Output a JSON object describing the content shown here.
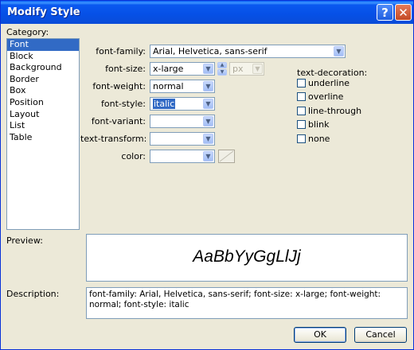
{
  "window": {
    "title": "Modify Style",
    "help_glyph": "?",
    "close_glyph": "✕"
  },
  "category": {
    "label": "Category:",
    "items": [
      "Font",
      "Block",
      "Background",
      "Border",
      "Box",
      "Position",
      "Layout",
      "List",
      "Table"
    ],
    "selected": "Font"
  },
  "font": {
    "family_label": "font-family:",
    "family_value": "Arial, Helvetica, sans-serif",
    "size_label": "font-size:",
    "size_value": "x-large",
    "size_unit": "px",
    "weight_label": "font-weight:",
    "weight_value": "normal",
    "style_label": "font-style:",
    "style_value": "italic",
    "variant_label": "font-variant:",
    "variant_value": "",
    "transform_label": "text-transform:",
    "transform_value": "",
    "color_label": "color:",
    "color_value": ""
  },
  "decoration": {
    "label": "text-decoration:",
    "options": [
      {
        "label": "underline",
        "checked": false
      },
      {
        "label": "overline",
        "checked": false
      },
      {
        "label": "line-through",
        "checked": false
      },
      {
        "label": "blink",
        "checked": false
      },
      {
        "label": "none",
        "checked": false
      }
    ]
  },
  "preview": {
    "label": "Preview:",
    "sample_text": "AaBbYyGgLlJj"
  },
  "description": {
    "label": "Description:",
    "text": "font-family: Arial, Helvetica, sans-serif; font-size: x-large; font-weight: normal; font-style: italic"
  },
  "buttons": {
    "ok": "OK",
    "cancel": "Cancel"
  },
  "icons": {
    "dropdown": "chevron-down-icon",
    "spin_up": "▲",
    "spin_down": "▼",
    "arrow": "▼"
  },
  "colors": {
    "titlebar": "#0a59f0",
    "dialog_bg": "#ece9d8",
    "selection": "#316ac5"
  }
}
